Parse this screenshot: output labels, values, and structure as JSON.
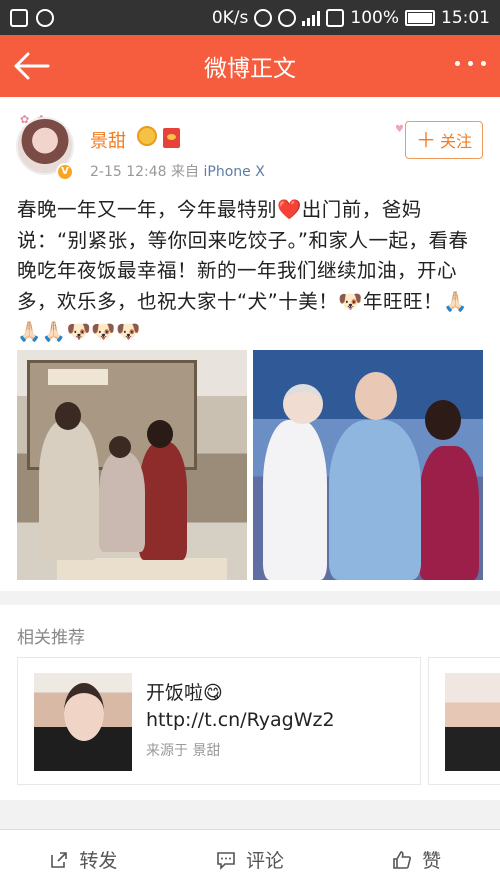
{
  "status_bar": {
    "network_speed": "0K/s",
    "network_type": "4G",
    "battery": "100%",
    "time": "15:01",
    "icons": [
      "gallery-icon",
      "weibo-icon",
      "headphones-icon",
      "alarm-icon",
      "signal-icon",
      "sim-icon",
      "battery-icon"
    ]
  },
  "header": {
    "title": "微博正文",
    "back_icon": "back-arrow-icon",
    "more_icon": "more-dots-icon"
  },
  "post": {
    "author": "景甜",
    "time": "2-15 12:48",
    "source_prefix": "来自",
    "source": "iPhone X",
    "follow_label": "关注",
    "follow_icon": "plus-icon",
    "text": "春晚一年又一年，今年最特别❤️出门前，爸妈说：“别紧张，等你回来吃饺子。”和家人一起，看春晚吃年夜饭最幸福！新的一年我们继续加油，开心多，欢乐多，也祝大家十“犬”十美！🐶年旺旺！🙏🏻🙏🏻🙏🏻🐶🐶🐶",
    "images": [
      "family-old-photo",
      "family-recent-photo"
    ]
  },
  "related": {
    "title": "相关推荐",
    "card": {
      "text": "开饭啦😋 http://t.cn/RyagWz2",
      "source": "来源于 景甜"
    }
  },
  "bottom_bar": {
    "repost_label": "转发",
    "comment_label": "评论",
    "like_label": "赞"
  },
  "colors": {
    "header_bg": "#f65d3e",
    "accent_orange": "#f47b20",
    "status_bar_bg": "#333333"
  }
}
